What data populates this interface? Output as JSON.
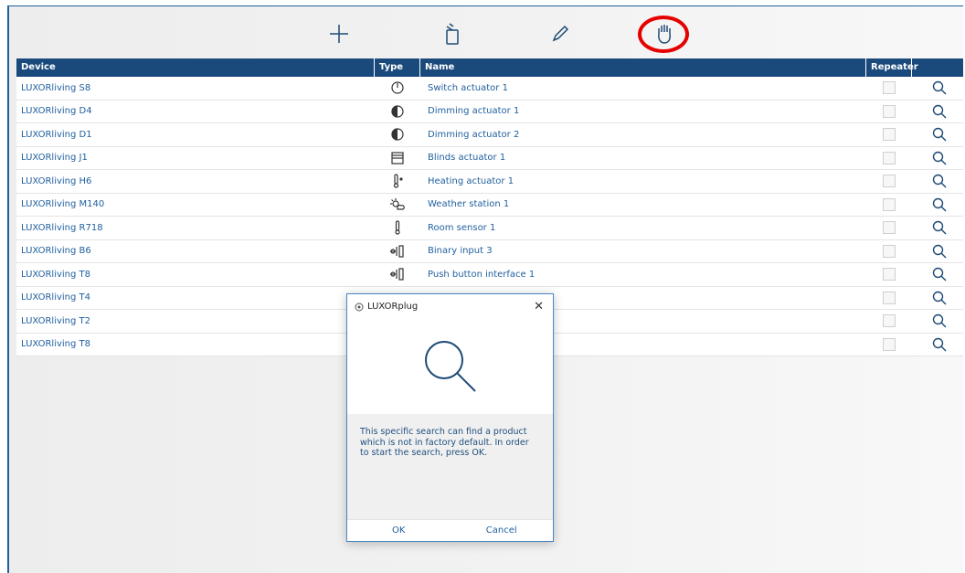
{
  "toolbar": {
    "add_icon": "plus-icon",
    "delete_icon": "trash-icon",
    "edit_icon": "pencil-icon",
    "manual_search_icon": "hand-icon",
    "highlight_color": "#e60000"
  },
  "table": {
    "headers": {
      "device": "Device",
      "type": "Type",
      "name": "Name",
      "repeater": "Repeater"
    },
    "rows": [
      {
        "device": "LUXORliving S8",
        "type_icon": "switch-icon",
        "name": "Switch actuator 1"
      },
      {
        "device": "LUXORliving D4",
        "type_icon": "dimmer-icon",
        "name": "Dimming actuator 1"
      },
      {
        "device": "LUXORliving D1",
        "type_icon": "dimmer-icon",
        "name": "Dimming actuator 2"
      },
      {
        "device": "LUXORliving J1",
        "type_icon": "blinds-icon",
        "name": "Blinds actuator 1"
      },
      {
        "device": "LUXORliving H6",
        "type_icon": "heating-icon",
        "name": "Heating actuator 1"
      },
      {
        "device": "LUXORliving M140",
        "type_icon": "weather-icon",
        "name": "Weather station 1"
      },
      {
        "device": "LUXORliving R718",
        "type_icon": "thermometer-icon",
        "name": "Room sensor 1"
      },
      {
        "device": "LUXORliving B6",
        "type_icon": "binary-input-icon",
        "name": "Binary input 3"
      },
      {
        "device": "LUXORliving T8",
        "type_icon": "binary-input-icon",
        "name": "Push button interface 1"
      },
      {
        "device": "LUXORliving T4",
        "type_icon": "",
        "name": ""
      },
      {
        "device": "LUXORliving T2",
        "type_icon": "",
        "name": ""
      },
      {
        "device": "LUXORliving T8",
        "type_icon": "",
        "name": ""
      }
    ]
  },
  "dialog": {
    "title": "LUXORplug",
    "close": "✕",
    "message": "This specific search can find a product which is not in factory default. In order to start the search, press OK.",
    "ok_label": "OK",
    "cancel_label": "Cancel"
  },
  "colors": {
    "header_bg": "#1a4a7c",
    "accent": "#1f5f9e"
  }
}
